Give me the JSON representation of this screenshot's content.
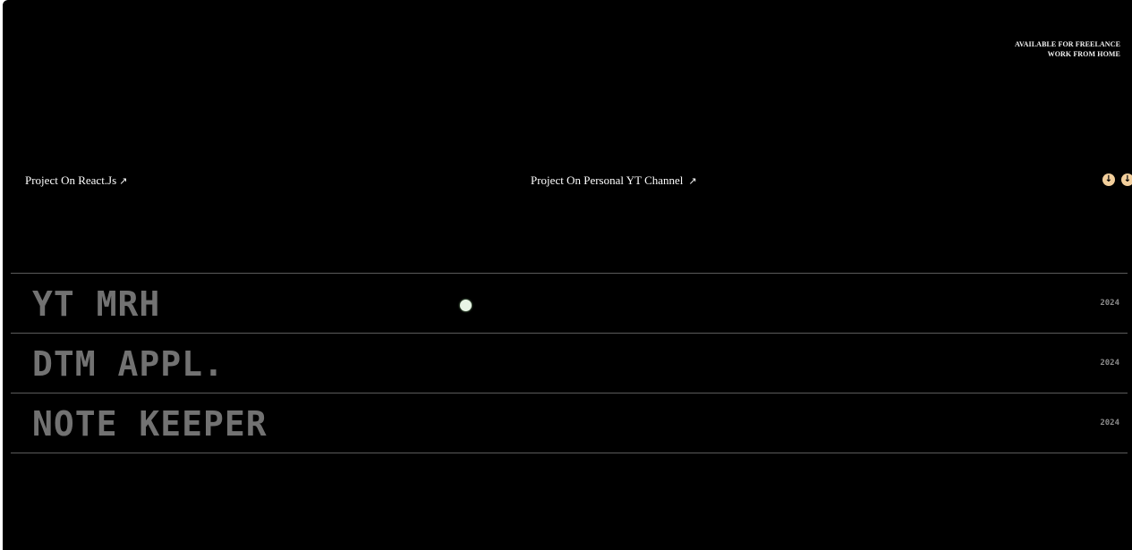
{
  "header": {
    "tagline_line1": "AVAILABLE FOR FREELANCE",
    "tagline_line2": "WORK FROM HOME"
  },
  "links": {
    "left": {
      "label": "Project On React.Js",
      "icon": "arrow-up-right-icon",
      "arrow": "↗"
    },
    "center": {
      "label": "Project On Personal YT Channel",
      "icon": "arrow-up-right-icon",
      "arrow": "↗"
    }
  },
  "download_icons": {
    "icon": "arrow-down-circle-icon",
    "glyph": "↓",
    "color": "#f3cf9c"
  },
  "projects": [
    {
      "name": "YT MRH",
      "year": "2024"
    },
    {
      "name": "DTM APPL.",
      "year": "2024"
    },
    {
      "name": "NOTE KEEPER",
      "year": "2024"
    }
  ],
  "colors": {
    "background": "#000000",
    "project_text": "#727272",
    "divider": "#5b5b5b",
    "accent": "#f3cf9c"
  }
}
